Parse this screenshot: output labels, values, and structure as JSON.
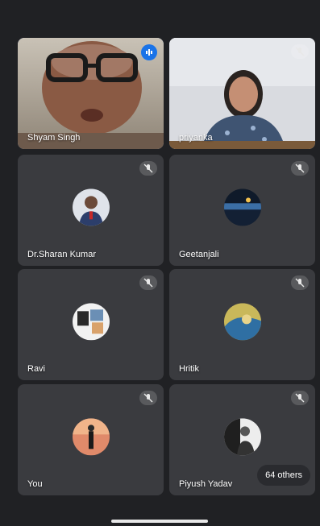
{
  "participants": [
    {
      "name": "Shyam Singh",
      "state": "speaking"
    },
    {
      "name": "priyanka",
      "state": "muted"
    },
    {
      "name": "Dr.Sharan Kumar",
      "state": "muted"
    },
    {
      "name": "Geetanjali",
      "state": "muted"
    },
    {
      "name": "Ravi",
      "state": "muted"
    },
    {
      "name": "Hritik",
      "state": "muted"
    },
    {
      "name": "You",
      "state": "muted"
    },
    {
      "name": "Piyush Yadav",
      "state": "muted"
    }
  ],
  "others": {
    "label": "64 others"
  },
  "colors": {
    "active_outline": "#7fb3ff",
    "speaking_badge": "#1a73e8",
    "tile_bg": "#3a3b3f"
  }
}
